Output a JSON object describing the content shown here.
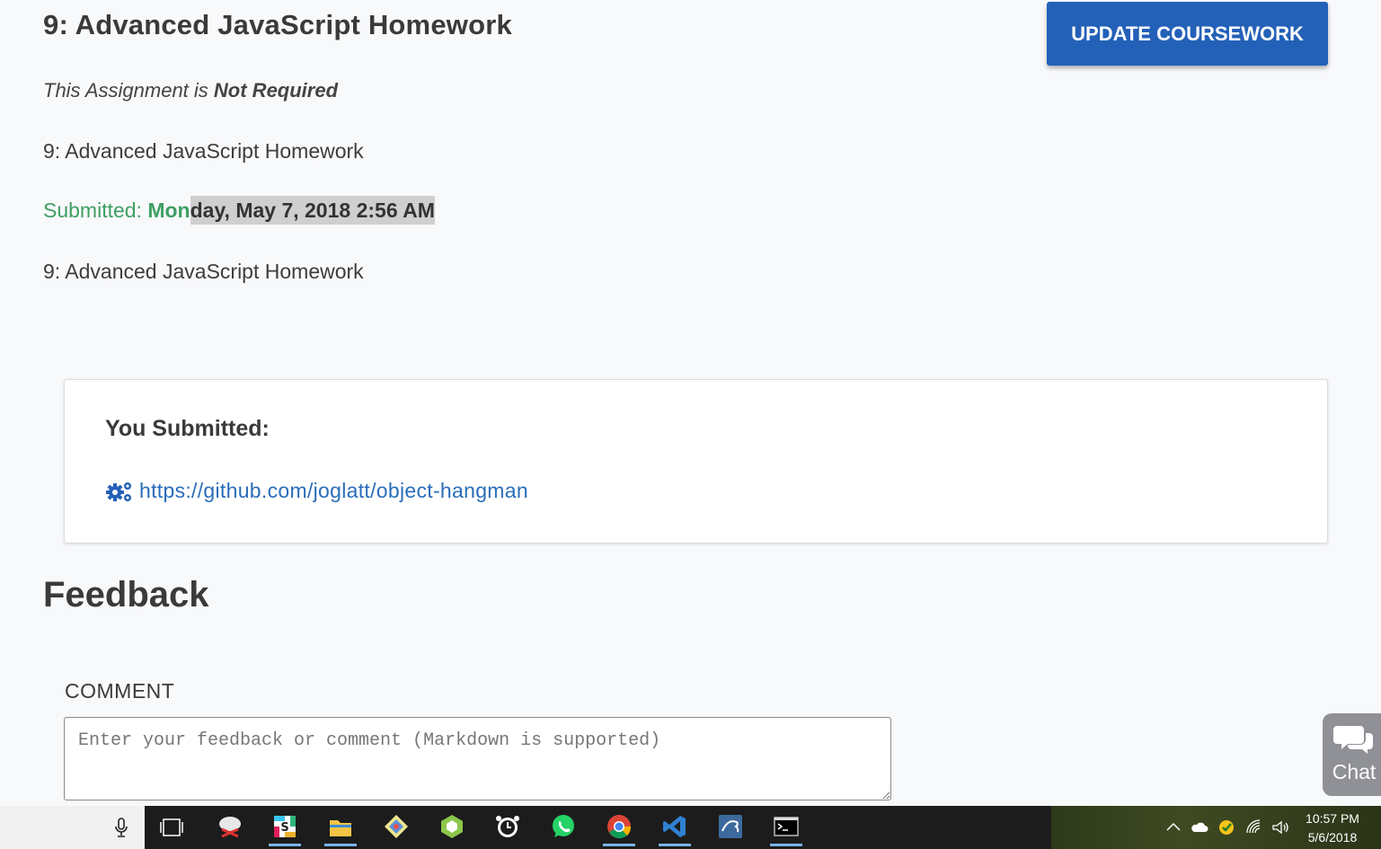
{
  "page": {
    "title": "9: Advanced JavaScript Homework",
    "update_button": "UPDATE COURSEWORK",
    "required_prefix": "This Assignment is ",
    "required_status": "Not Required",
    "description_1": "9: Advanced JavaScript Homework",
    "submitted_label": "Submitted: ",
    "submitted_date_part1": "Mon",
    "submitted_date_part2": "day, May 7, 2018 2:56 AM",
    "description_2": "9: Advanced JavaScript Homework"
  },
  "submission": {
    "heading": "You Submitted:",
    "link": "https://github.com/joglatt/object-hangman",
    "icon": "gears-icon"
  },
  "feedback": {
    "title": "Feedback",
    "comment_label": "COMMENT",
    "comment_placeholder": "Enter your feedback or comment (Markdown is supported)",
    "comment_value": ""
  },
  "chat": {
    "label": "Chat"
  },
  "taskbar": {
    "apps": [
      "snipping-tool",
      "slack",
      "file-explorer",
      "gitkraken",
      "node",
      "alarm",
      "whatsapp",
      "chrome",
      "vscode",
      "mysql-workbench",
      "terminal"
    ],
    "clock": {
      "time": "10:57 PM",
      "date": "5/6/2018"
    }
  },
  "colors": {
    "primary": "#2361b8",
    "success": "#3f9f63",
    "link": "#2a6db8"
  }
}
